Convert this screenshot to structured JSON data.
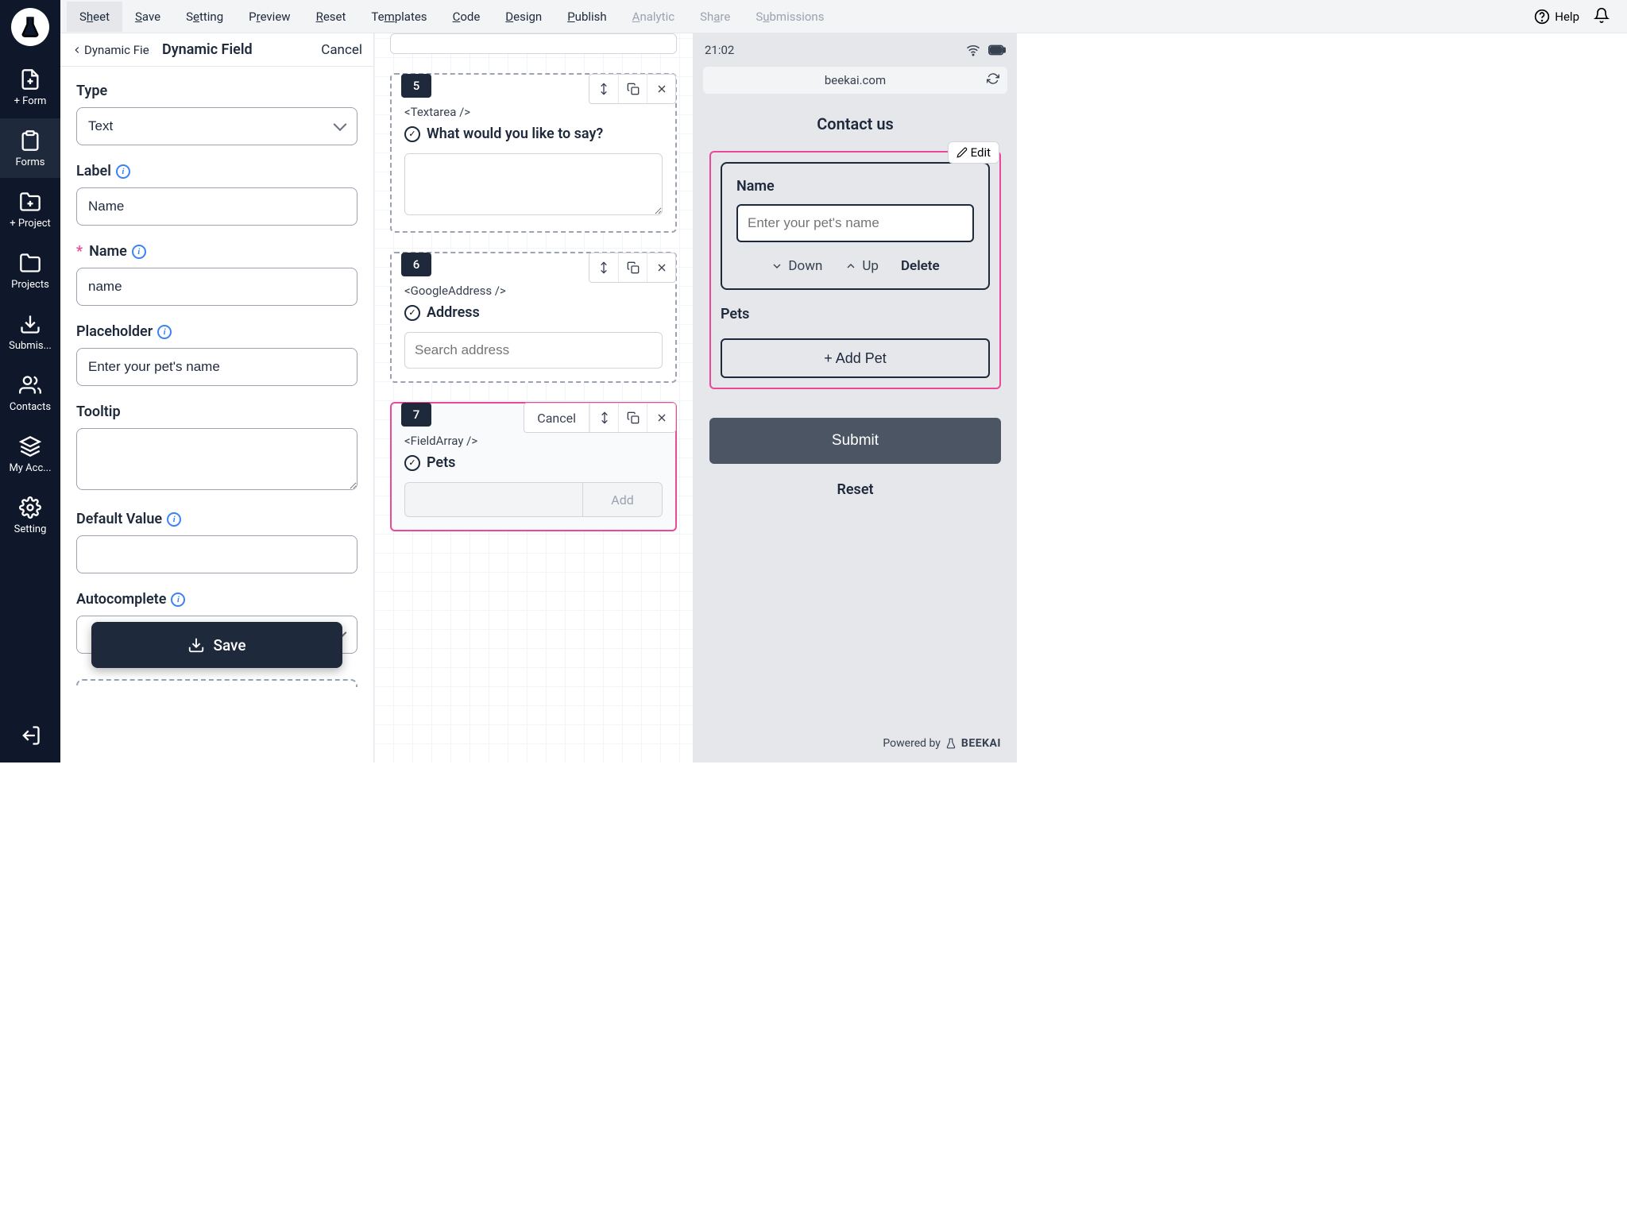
{
  "topbar": {
    "items": [
      {
        "pre": "S",
        "u": "h",
        "post": "eet",
        "active": true
      },
      {
        "pre": "",
        "u": "S",
        "post": "ave"
      },
      {
        "pre": "S",
        "u": "e",
        "post": "tting"
      },
      {
        "pre": "P",
        "u": "r",
        "post": "eview"
      },
      {
        "pre": "",
        "u": "R",
        "post": "eset"
      },
      {
        "pre": "Te",
        "u": "m",
        "post": "plates"
      },
      {
        "pre": "",
        "u": "C",
        "post": "ode"
      },
      {
        "pre": "",
        "u": "D",
        "post": "esign"
      },
      {
        "pre": "",
        "u": "P",
        "post": "ublish"
      },
      {
        "pre": "",
        "u": "A",
        "post": "nalytic",
        "disabled": true
      },
      {
        "pre": "Sh",
        "u": "a",
        "post": "re",
        "disabled": true
      },
      {
        "pre": "S",
        "u": "u",
        "post": "bmissions",
        "disabled": true
      }
    ],
    "help": "Help"
  },
  "sidebar": {
    "items": [
      "+ Form",
      "Forms",
      "+ Project",
      "Projects",
      "Submis...",
      "Contacts",
      "My Acc...",
      "Setting"
    ]
  },
  "props": {
    "crumb": "Dynamic Fie",
    "title": "Dynamic Field",
    "cancel": "Cancel",
    "type_label": "Type",
    "type_value": "Text",
    "label_label": "Label",
    "label_value": "Name",
    "name_label": "Name",
    "name_value": "name",
    "placeholder_label": "Placeholder",
    "placeholder_value": "Enter your pet's name",
    "tooltip_label": "Tooltip",
    "tooltip_value": "",
    "default_label": "Default Value",
    "default_value": "",
    "autocomplete_label": "Autocomplete",
    "save": "Save"
  },
  "canvas": {
    "cards": [
      {
        "num": "5",
        "type": "<Textarea />",
        "title": "What would you like to say?"
      },
      {
        "num": "6",
        "type": "<GoogleAddress />",
        "title": "Address",
        "placeholder": "Search address"
      },
      {
        "num": "7",
        "type": "<FieldArray />",
        "title": "Pets",
        "cancel": "Cancel",
        "add": "Add",
        "selected": true
      }
    ]
  },
  "preview": {
    "time": "21:02",
    "url": "beekai.com",
    "heading": "Contact us",
    "edit": "Edit",
    "name_label": "Name",
    "name_placeholder": "Enter your pet's name",
    "down": "Down",
    "up": "Up",
    "delete": "Delete",
    "pets_label": "Pets",
    "add_pet": "+ Add Pet",
    "submit": "Submit",
    "reset": "Reset",
    "powered_pre": "Powered by",
    "powered_brand": "BEEKAI"
  }
}
